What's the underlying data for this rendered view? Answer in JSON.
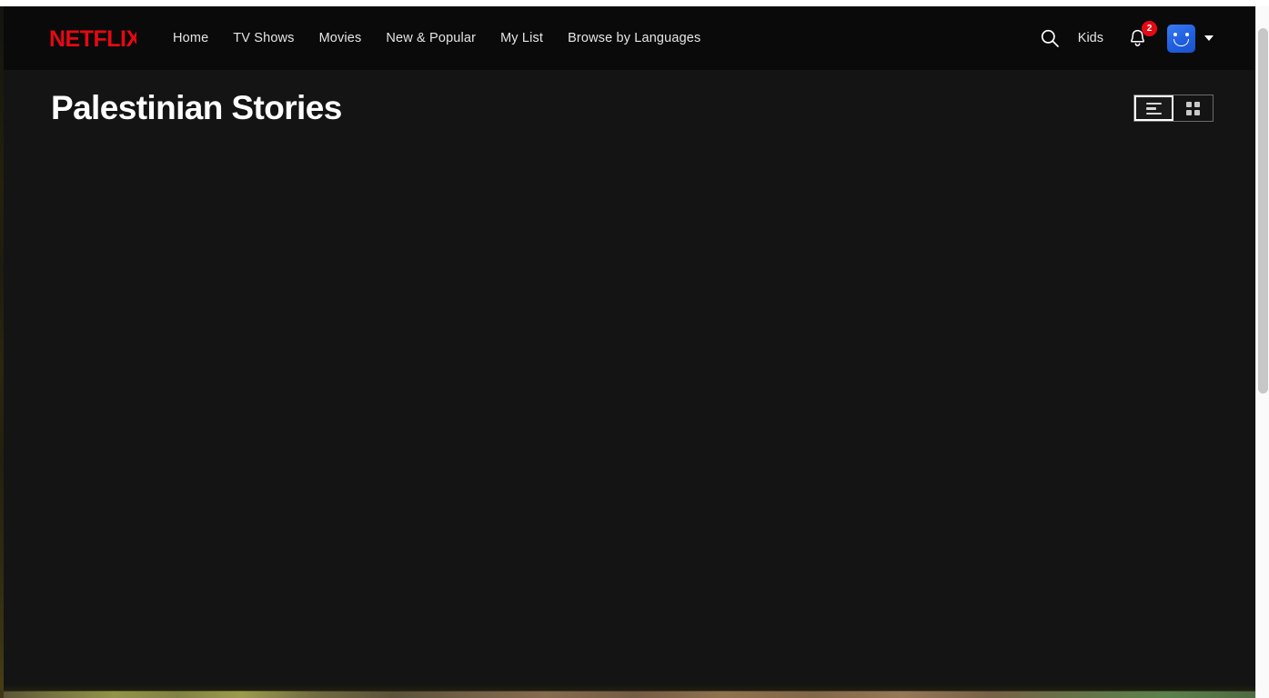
{
  "header": {
    "brand": "NETFLIX",
    "brand_color": "#e50914",
    "nav_items": [
      {
        "label": "Home",
        "name": "nav-home"
      },
      {
        "label": "TV Shows",
        "name": "nav-tv-shows"
      },
      {
        "label": "Movies",
        "name": "nav-movies"
      },
      {
        "label": "New & Popular",
        "name": "nav-new-and-popular"
      },
      {
        "label": "My List",
        "name": "nav-my-list"
      },
      {
        "label": "Browse by Languages",
        "name": "nav-browse-by-languages"
      }
    ],
    "search_icon": "search-icon",
    "kids_label": "Kids",
    "notifications": {
      "icon": "bell-icon",
      "badge_count": "2",
      "badge_color": "#e50914"
    },
    "account": {
      "avatar_icon": "smiley-avatar-icon",
      "avatar_color": "#2563eb",
      "caret_icon": "chevron-down-icon"
    },
    "background_color": "#0a0a0a"
  },
  "page": {
    "title": "Palestinian Stories",
    "background_color": "#141414",
    "view_toggle": {
      "options": [
        {
          "label": "List view",
          "icon": "list-view-icon",
          "active": true
        },
        {
          "label": "Grid view",
          "icon": "grid-view-icon",
          "active": false
        }
      ]
    },
    "results": {
      "items": [],
      "empty_text": ""
    }
  },
  "scrollbar": {
    "orientation": "vertical",
    "thumb_color": "#c7c7c7",
    "track_color": "#fafafa"
  }
}
